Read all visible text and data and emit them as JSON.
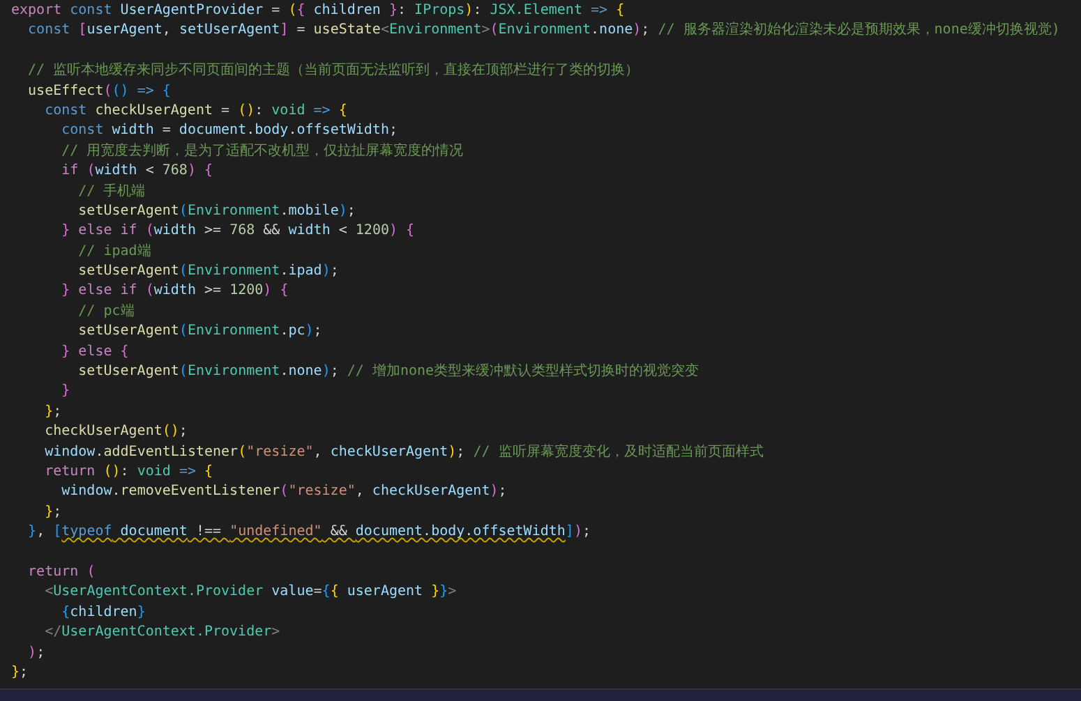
{
  "editor": {
    "lines": [
      {
        "kind": "code",
        "tokens": [
          {
            "kind": "ctrl",
            "text": "export"
          },
          {
            "kind": "kw",
            "text": " const"
          },
          {
            "kind": "var",
            "text": " UserAgentProvider"
          },
          {
            "kind": "p",
            "text": " = "
          },
          {
            "kind": "b1",
            "text": "("
          },
          {
            "kind": "b2",
            "text": "{"
          },
          {
            "kind": "var",
            "text": " children "
          },
          {
            "kind": "b2",
            "text": "}"
          },
          {
            "kind": "p",
            "text": ": "
          },
          {
            "kind": "type",
            "text": "IProps"
          },
          {
            "kind": "b1",
            "text": ")"
          },
          {
            "kind": "p",
            "text": ": "
          },
          {
            "kind": "type",
            "text": "JSX.Element"
          },
          {
            "kind": "kw",
            "text": " =>"
          },
          {
            "kind": "b1",
            "text": " {"
          }
        ]
      },
      {
        "kind": "code",
        "tokens": [
          {
            "kind": "kw",
            "text": "  const"
          },
          {
            "kind": "b2",
            "text": " ["
          },
          {
            "kind": "var",
            "text": "userAgent"
          },
          {
            "kind": "p",
            "text": ", "
          },
          {
            "kind": "var",
            "text": "setUserAgent"
          },
          {
            "kind": "b2",
            "text": "]"
          },
          {
            "kind": "p",
            "text": " = "
          },
          {
            "kind": "fn",
            "text": "useState"
          },
          {
            "kind": "tagp",
            "text": "<"
          },
          {
            "kind": "type",
            "text": "Environment"
          },
          {
            "kind": "tagp",
            "text": ">"
          },
          {
            "kind": "b2",
            "text": "("
          },
          {
            "kind": "type",
            "text": "Environment"
          },
          {
            "kind": "p",
            "text": "."
          },
          {
            "kind": "var",
            "text": "none"
          },
          {
            "kind": "b2",
            "text": ")"
          },
          {
            "kind": "p",
            "text": ";"
          },
          {
            "kind": "cmt",
            "text": " // 服务器渲染初始化渲染未必是预期效果，none缓冲切换视觉)"
          }
        ]
      },
      {
        "kind": "blank"
      },
      {
        "kind": "code",
        "tokens": [
          {
            "kind": "cmt",
            "text": "  // 监听本地缓存来同步不同页面间的主题（当前页面无法监听到，直接在顶部栏进行了类的切换）"
          }
        ]
      },
      {
        "kind": "code",
        "tokens": [
          {
            "kind": "fn",
            "text": "  useEffect"
          },
          {
            "kind": "b2",
            "text": "("
          },
          {
            "kind": "b3",
            "text": "()"
          },
          {
            "kind": "kw",
            "text": " =>"
          },
          {
            "kind": "b3",
            "text": " {"
          }
        ]
      },
      {
        "kind": "code",
        "tokens": [
          {
            "kind": "kw",
            "text": "    const"
          },
          {
            "kind": "fn",
            "text": " checkUserAgent"
          },
          {
            "kind": "p",
            "text": " = "
          },
          {
            "kind": "b1",
            "text": "()"
          },
          {
            "kind": "p",
            "text": ": "
          },
          {
            "kind": "type",
            "text": "void"
          },
          {
            "kind": "kw",
            "text": " =>"
          },
          {
            "kind": "b1",
            "text": " {"
          }
        ]
      },
      {
        "kind": "code",
        "tokens": [
          {
            "kind": "kw",
            "text": "      const"
          },
          {
            "kind": "var",
            "text": " width"
          },
          {
            "kind": "p",
            "text": " = "
          },
          {
            "kind": "var",
            "text": "document"
          },
          {
            "kind": "p",
            "text": "."
          },
          {
            "kind": "var",
            "text": "body"
          },
          {
            "kind": "p",
            "text": "."
          },
          {
            "kind": "var",
            "text": "offsetWidth"
          },
          {
            "kind": "p",
            "text": ";"
          }
        ]
      },
      {
        "kind": "code",
        "tokens": [
          {
            "kind": "cmt",
            "text": "      // 用宽度去判断，是为了适配不改机型，仅拉扯屏幕宽度的情况"
          }
        ]
      },
      {
        "kind": "code",
        "tokens": [
          {
            "kind": "ctrl",
            "text": "      if"
          },
          {
            "kind": "b2",
            "text": " ("
          },
          {
            "kind": "var",
            "text": "width"
          },
          {
            "kind": "p",
            "text": " < "
          },
          {
            "kind": "num",
            "text": "768"
          },
          {
            "kind": "b2",
            "text": ")"
          },
          {
            "kind": "b2",
            "text": " {"
          }
        ]
      },
      {
        "kind": "code",
        "tokens": [
          {
            "kind": "cmt",
            "text": "        // 手机端"
          }
        ]
      },
      {
        "kind": "code",
        "tokens": [
          {
            "kind": "fn",
            "text": "        setUserAgent"
          },
          {
            "kind": "b3",
            "text": "("
          },
          {
            "kind": "type",
            "text": "Environment"
          },
          {
            "kind": "p",
            "text": "."
          },
          {
            "kind": "var",
            "text": "mobile"
          },
          {
            "kind": "b3",
            "text": ")"
          },
          {
            "kind": "p",
            "text": ";"
          }
        ]
      },
      {
        "kind": "code",
        "tokens": [
          {
            "kind": "b2",
            "text": "      }"
          },
          {
            "kind": "ctrl",
            "text": " else if"
          },
          {
            "kind": "b2",
            "text": " ("
          },
          {
            "kind": "var",
            "text": "width"
          },
          {
            "kind": "p",
            "text": " >= "
          },
          {
            "kind": "num",
            "text": "768"
          },
          {
            "kind": "p",
            "text": " && "
          },
          {
            "kind": "var",
            "text": "width"
          },
          {
            "kind": "p",
            "text": " < "
          },
          {
            "kind": "num",
            "text": "1200"
          },
          {
            "kind": "b2",
            "text": ")"
          },
          {
            "kind": "b2",
            "text": " {"
          }
        ]
      },
      {
        "kind": "code",
        "tokens": [
          {
            "kind": "cmt",
            "text": "        // ipad端"
          }
        ]
      },
      {
        "kind": "code",
        "tokens": [
          {
            "kind": "fn",
            "text": "        setUserAgent"
          },
          {
            "kind": "b3",
            "text": "("
          },
          {
            "kind": "type",
            "text": "Environment"
          },
          {
            "kind": "p",
            "text": "."
          },
          {
            "kind": "var",
            "text": "ipad"
          },
          {
            "kind": "b3",
            "text": ")"
          },
          {
            "kind": "p",
            "text": ";"
          }
        ]
      },
      {
        "kind": "code",
        "tokens": [
          {
            "kind": "b2",
            "text": "      }"
          },
          {
            "kind": "ctrl",
            "text": " else if"
          },
          {
            "kind": "b2",
            "text": " ("
          },
          {
            "kind": "var",
            "text": "width"
          },
          {
            "kind": "p",
            "text": " >= "
          },
          {
            "kind": "num",
            "text": "1200"
          },
          {
            "kind": "b2",
            "text": ")"
          },
          {
            "kind": "b2",
            "text": " {"
          }
        ]
      },
      {
        "kind": "code",
        "tokens": [
          {
            "kind": "cmt",
            "text": "        // pc端"
          }
        ]
      },
      {
        "kind": "code",
        "tokens": [
          {
            "kind": "fn",
            "text": "        setUserAgent"
          },
          {
            "kind": "b3",
            "text": "("
          },
          {
            "kind": "type",
            "text": "Environment"
          },
          {
            "kind": "p",
            "text": "."
          },
          {
            "kind": "var",
            "text": "pc"
          },
          {
            "kind": "b3",
            "text": ")"
          },
          {
            "kind": "p",
            "text": ";"
          }
        ]
      },
      {
        "kind": "code",
        "tokens": [
          {
            "kind": "b2",
            "text": "      }"
          },
          {
            "kind": "ctrl",
            "text": " else"
          },
          {
            "kind": "b2",
            "text": " {"
          }
        ]
      },
      {
        "kind": "code",
        "tokens": [
          {
            "kind": "fn",
            "text": "        setUserAgent"
          },
          {
            "kind": "b3",
            "text": "("
          },
          {
            "kind": "type",
            "text": "Environment"
          },
          {
            "kind": "p",
            "text": "."
          },
          {
            "kind": "var",
            "text": "none"
          },
          {
            "kind": "b3",
            "text": ")"
          },
          {
            "kind": "p",
            "text": ";"
          },
          {
            "kind": "cmt",
            "text": " // 增加none类型来缓冲默认类型样式切换时的视觉突变"
          }
        ]
      },
      {
        "kind": "code",
        "tokens": [
          {
            "kind": "b2",
            "text": "      }"
          }
        ]
      },
      {
        "kind": "code",
        "tokens": [
          {
            "kind": "b1",
            "text": "    }"
          },
          {
            "kind": "p",
            "text": ";"
          }
        ]
      },
      {
        "kind": "code",
        "tokens": [
          {
            "kind": "fn",
            "text": "    checkUserAgent"
          },
          {
            "kind": "b1",
            "text": "()"
          },
          {
            "kind": "p",
            "text": ";"
          }
        ]
      },
      {
        "kind": "code",
        "tokens": [
          {
            "kind": "var",
            "text": "    window"
          },
          {
            "kind": "p",
            "text": "."
          },
          {
            "kind": "fn",
            "text": "addEventListener"
          },
          {
            "kind": "b1",
            "text": "("
          },
          {
            "kind": "str",
            "text": "\"resize\""
          },
          {
            "kind": "p",
            "text": ", "
          },
          {
            "kind": "var",
            "text": "checkUserAgent"
          },
          {
            "kind": "b1",
            "text": ")"
          },
          {
            "kind": "p",
            "text": ";"
          },
          {
            "kind": "cmt",
            "text": " // 监听屏幕宽度变化，及时适配当前页面样式"
          }
        ]
      },
      {
        "kind": "code",
        "tokens": [
          {
            "kind": "ctrl",
            "text": "    return"
          },
          {
            "kind": "b1",
            "text": " ()"
          },
          {
            "kind": "p",
            "text": ": "
          },
          {
            "kind": "type",
            "text": "void"
          },
          {
            "kind": "kw",
            "text": " =>"
          },
          {
            "kind": "b1",
            "text": " {"
          }
        ]
      },
      {
        "kind": "code",
        "tokens": [
          {
            "kind": "var",
            "text": "      window"
          },
          {
            "kind": "p",
            "text": "."
          },
          {
            "kind": "fn",
            "text": "removeEventListener"
          },
          {
            "kind": "b2",
            "text": "("
          },
          {
            "kind": "str",
            "text": "\"resize\""
          },
          {
            "kind": "p",
            "text": ", "
          },
          {
            "kind": "var",
            "text": "checkUserAgent"
          },
          {
            "kind": "b2",
            "text": ")"
          },
          {
            "kind": "p",
            "text": ";"
          }
        ]
      },
      {
        "kind": "code",
        "tokens": [
          {
            "kind": "b1",
            "text": "    }"
          },
          {
            "kind": "p",
            "text": ";"
          }
        ]
      },
      {
        "kind": "code",
        "tokens": [
          {
            "kind": "b3",
            "text": "  }"
          },
          {
            "kind": "p",
            "text": ","
          },
          {
            "kind": "b3",
            "text": " ["
          },
          {
            "kind": "kw",
            "text": "typeof",
            "warning": true
          },
          {
            "kind": "var",
            "text": " document",
            "warning": true
          },
          {
            "kind": "p",
            "text": " !== ",
            "warning": true
          },
          {
            "kind": "str",
            "text": "\"undefined\"",
            "warning": true
          },
          {
            "kind": "p",
            "text": " && ",
            "warning": true
          },
          {
            "kind": "var",
            "text": "document.body.offsetWidth",
            "warning": true
          },
          {
            "kind": "b3",
            "text": "]"
          },
          {
            "kind": "b2",
            "text": ")"
          },
          {
            "kind": "p",
            "text": ";"
          }
        ]
      },
      {
        "kind": "blank"
      },
      {
        "kind": "code",
        "tokens": [
          {
            "kind": "ctrl",
            "text": "  return"
          },
          {
            "kind": "b2",
            "text": " ("
          }
        ]
      },
      {
        "kind": "code",
        "tokens": [
          {
            "kind": "tagp",
            "text": "    <"
          },
          {
            "kind": "type",
            "text": "UserAgentContext.Provider"
          },
          {
            "kind": "var",
            "text": " value"
          },
          {
            "kind": "p",
            "text": "="
          },
          {
            "kind": "b3",
            "text": "{"
          },
          {
            "kind": "b1",
            "text": "{"
          },
          {
            "kind": "var",
            "text": " userAgent "
          },
          {
            "kind": "b1",
            "text": "}"
          },
          {
            "kind": "b3",
            "text": "}"
          },
          {
            "kind": "tagp",
            "text": ">"
          }
        ]
      },
      {
        "kind": "code",
        "tokens": [
          {
            "kind": "b3",
            "text": "      {"
          },
          {
            "kind": "var",
            "text": "children"
          },
          {
            "kind": "b3",
            "text": "}"
          }
        ]
      },
      {
        "kind": "code",
        "tokens": [
          {
            "kind": "tagp",
            "text": "    </"
          },
          {
            "kind": "type",
            "text": "UserAgentContext.Provider"
          },
          {
            "kind": "tagp",
            "text": ">"
          }
        ]
      },
      {
        "kind": "code",
        "tokens": [
          {
            "kind": "b2",
            "text": "  )"
          },
          {
            "kind": "p",
            "text": ";"
          }
        ]
      },
      {
        "kind": "code",
        "tokens": [
          {
            "kind": "b1",
            "text": "}"
          },
          {
            "kind": "p",
            "text": ";"
          }
        ]
      }
    ]
  }
}
